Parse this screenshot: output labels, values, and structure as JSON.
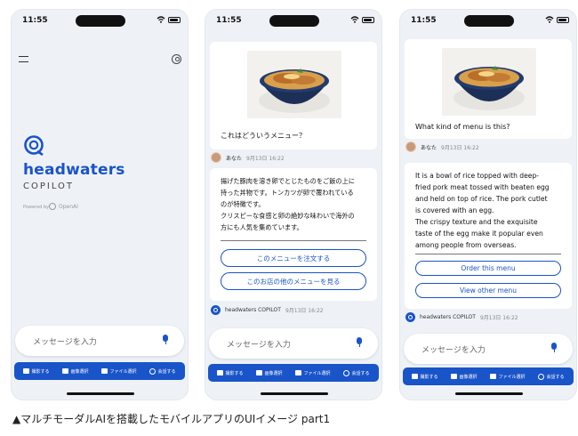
{
  "status": {
    "time": "11:55"
  },
  "splash": {
    "brand": "headwaters",
    "sub": "COPILOT",
    "powered": "Powered by",
    "openai": "OpenAI"
  },
  "input": {
    "placeholder": "メッセージを入力"
  },
  "toolbar": {
    "camera": "撮影する",
    "image": "画像選択",
    "file": "ファイル選択",
    "voice": "会話する"
  },
  "chat_jp": {
    "question": "これはどういうメニュー？",
    "user_name": "あなた",
    "user_time": "9月13日 16:22",
    "answer": "揚げた豚肉を溶き卵でとじたものをご飯の上に\n持った丼物です。トンカツが卵で覆われている\nのが特徴です。\nクリスピーな食感と卵の絶妙な味わいで海外の\n方にも人気を集めています。",
    "btn_order": "このメニューを注文する",
    "btn_other": "このお店の他のメニューを見る",
    "bot_name": "headwaters COPILOT",
    "bot_time": "9月13日 16:22"
  },
  "chat_en": {
    "question": "What kind of menu is this?",
    "user_name": "あなた",
    "user_time": "9月13日 16:22",
    "answer": "It is a bowl of rice topped with deep-\nfried pork meat tossed with beaten egg\nand held on top of rice. The pork cutlet\nis covered with an egg.\nThe crispy texture and the exquisite\ntaste of the egg make it popular even\namong people from overseas.",
    "btn_order": "Order this menu",
    "btn_other": "View other menu",
    "bot_name": "headwaters COPILOT",
    "bot_time": "9月13日 16:22"
  },
  "caption": "▲マルチモーダルAIを搭載したモバイルアプリのUIイメージ part1",
  "colors": {
    "accent": "#1a54c9",
    "bg": "#eef2f7"
  },
  "icons": [
    "menu-icon",
    "account-icon",
    "mic-icon",
    "camera-icon",
    "image-icon",
    "folder-icon",
    "headset-icon"
  ]
}
